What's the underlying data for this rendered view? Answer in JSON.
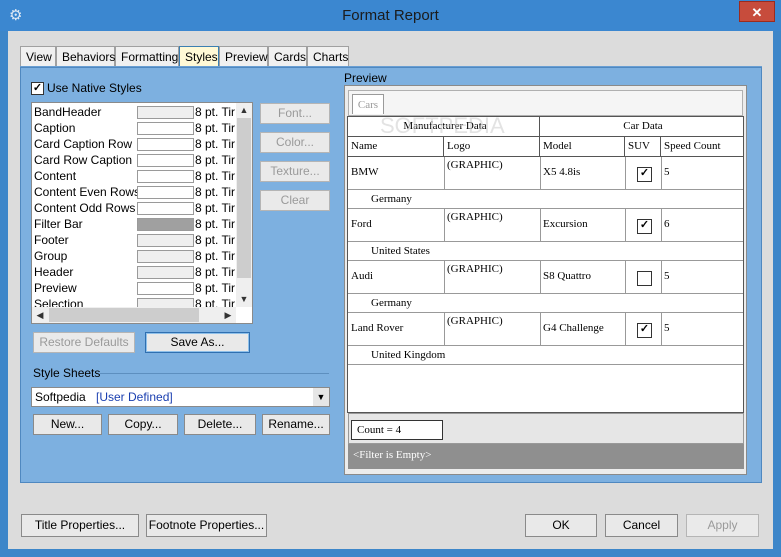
{
  "window": {
    "title": "Format Report",
    "close_glyph": "✕"
  },
  "tabs": [
    "View",
    "Behaviors",
    "Formatting",
    "Styles",
    "Preview",
    "Cards",
    "Charts"
  ],
  "active_tab": "Styles",
  "styles": {
    "use_native_label": "Use Native Styles",
    "use_native_checked": true,
    "items": [
      {
        "name": "BandHeader",
        "font": "8 pt. Tir"
      },
      {
        "name": "Caption",
        "font": "8 pt. Tir"
      },
      {
        "name": "Card Caption Row",
        "font": "8 pt. Tir"
      },
      {
        "name": "Card Row Caption",
        "font": "8 pt. Tir"
      },
      {
        "name": "Content",
        "font": "8 pt. Tir"
      },
      {
        "name": "Content Even Rows",
        "font": "8 pt. Tir"
      },
      {
        "name": "Content Odd Rows",
        "font": "8 pt. Tir"
      },
      {
        "name": "Filter Bar",
        "font": "8 pt. Tir"
      },
      {
        "name": "Footer",
        "font": "8 pt. Tir"
      },
      {
        "name": "Group",
        "font": "8 pt. Tir"
      },
      {
        "name": "Header",
        "font": "8 pt. Tir"
      },
      {
        "name": "Preview",
        "font": "8 pt. Tir"
      },
      {
        "name": "Selection",
        "font": "8 pt. Tir"
      }
    ],
    "swatch_colors": [
      "#efefef",
      "#ffffff",
      "#ffffff",
      "#ffffff",
      "#ffffff",
      "#ffffff",
      "#ffffff",
      "#a0a0a0",
      "#efefef",
      "#efefef",
      "#efefef",
      "#ffffff",
      "#efefef"
    ],
    "buttons": {
      "font": "Font...",
      "color": "Color...",
      "texture": "Texture...",
      "clear": "Clear"
    },
    "restore_defaults": "Restore Defaults",
    "save_as": "Save As..."
  },
  "style_sheets": {
    "label": "Style Sheets",
    "selected_name": "Softpedia",
    "selected_type": "[User Defined]",
    "buttons": {
      "new": "New...",
      "copy": "Copy...",
      "delete": "Delete...",
      "rename": "Rename..."
    }
  },
  "preview": {
    "label": "Preview",
    "tab_label": "Cars",
    "band_headers": [
      "Manufacturer Data",
      "Car Data"
    ],
    "columns": [
      "Name",
      "Logo",
      "Model",
      "SUV",
      "Speed Count"
    ],
    "rows": [
      {
        "name": "BMW",
        "logo": "(GRAPHIC)",
        "model": "X5 4.8is",
        "suv": true,
        "speed": "5",
        "country": "Germany"
      },
      {
        "name": "Ford",
        "logo": "(GRAPHIC)",
        "model": "Excursion",
        "suv": true,
        "speed": "6",
        "country": "United States"
      },
      {
        "name": "Audi",
        "logo": "(GRAPHIC)",
        "model": "S8 Quattro",
        "suv": false,
        "speed": "5",
        "country": "Germany"
      },
      {
        "name": "Land Rover",
        "logo": "(GRAPHIC)",
        "model": "G4 Challenge",
        "suv": true,
        "speed": "5",
        "country": "United Kingdom"
      }
    ],
    "footer_count": "Count = 4",
    "filter_text": "<Filter is Empty>",
    "watermark": "SOFTPEDIA"
  },
  "footer_buttons": {
    "title_properties": "Title Properties...",
    "footnote_properties": "Footnote Properties...",
    "ok": "OK",
    "cancel": "Cancel",
    "apply": "Apply"
  }
}
